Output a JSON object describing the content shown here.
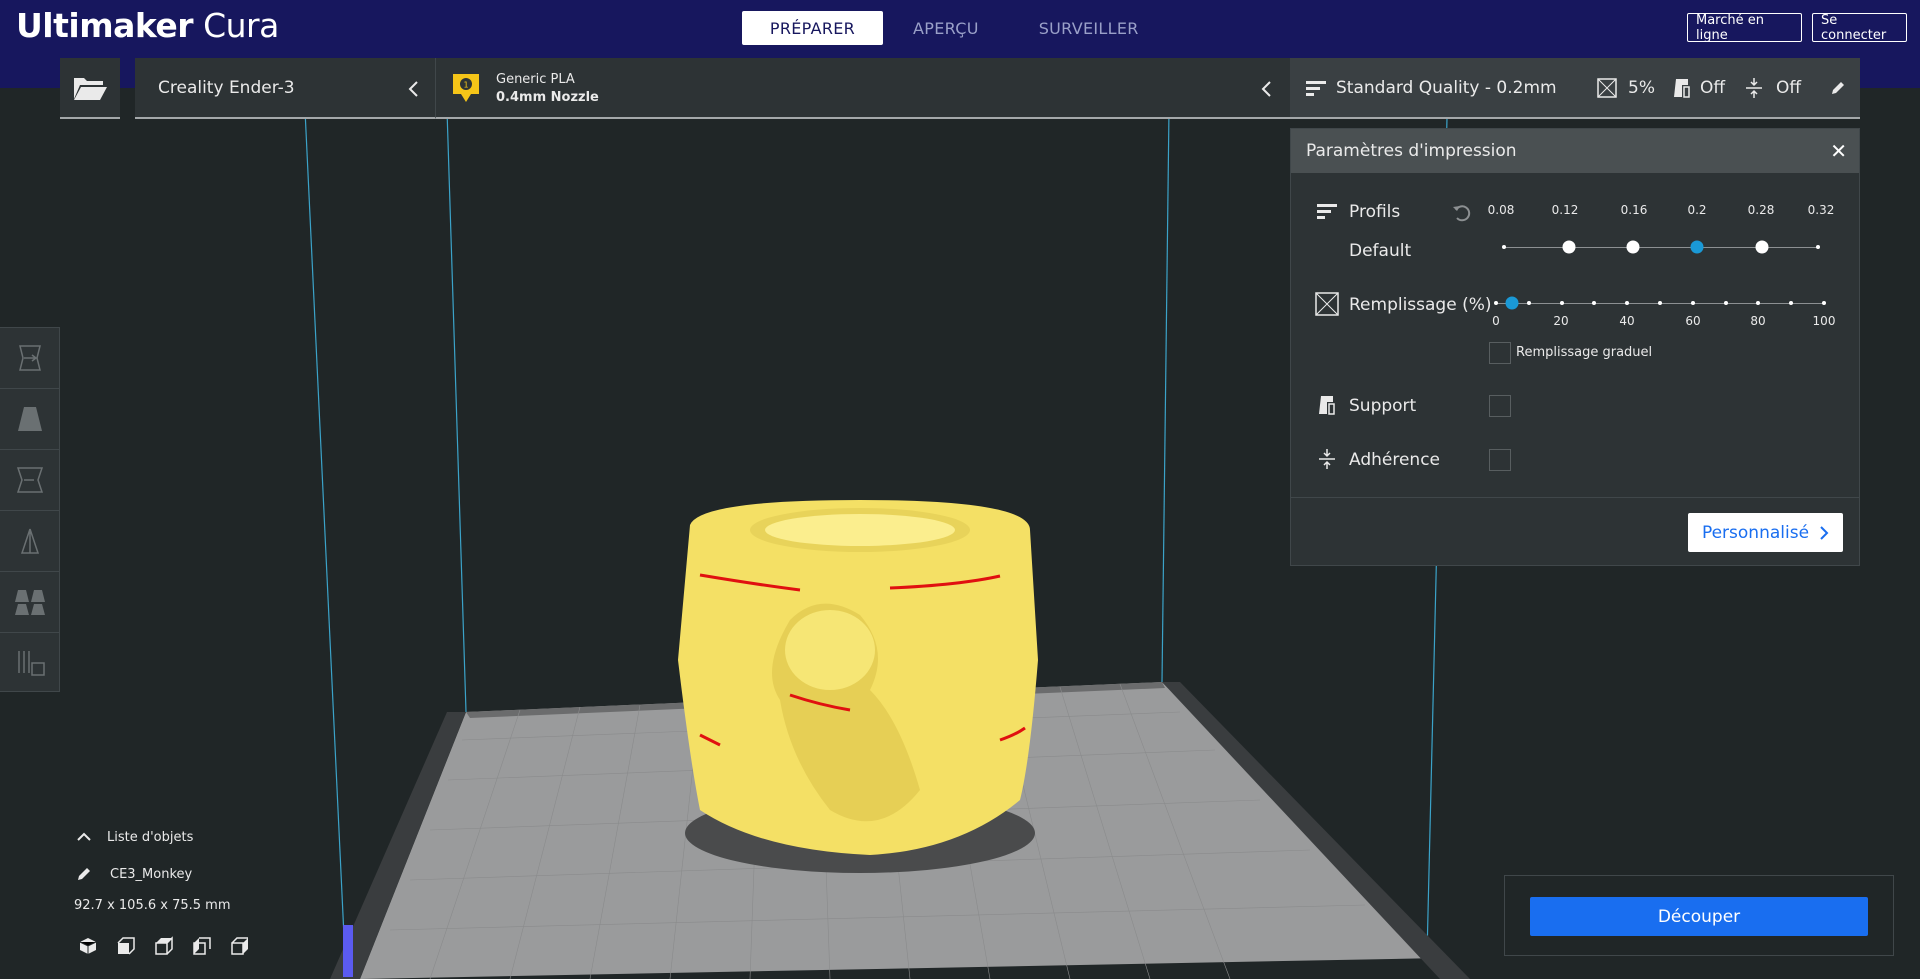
{
  "app": {
    "brand_bold": "Ultimaker",
    "brand_light": "Cura"
  },
  "stages": [
    {
      "label": "PRÉPARER",
      "active": true
    },
    {
      "label": "APERÇU",
      "active": false
    },
    {
      "label": "SURVEILLER",
      "active": false
    }
  ],
  "header_buttons": {
    "marketplace": "Marché en ligne",
    "signin": "Se connecter"
  },
  "printer": {
    "name": "Creality Ender-3"
  },
  "material": {
    "name": "Generic PLA",
    "nozzle": "0.4mm Nozzle",
    "extruder_index": "1"
  },
  "quality_bar": {
    "profile": "Standard Quality - 0.2mm",
    "infill": "5%",
    "support": "Off",
    "adhesion": "Off"
  },
  "print_settings": {
    "title": "Paramètres d'impression",
    "profiles_label": "Profils",
    "profile_default": "Default",
    "layer_heights": [
      "0.08",
      "0.12",
      "0.16",
      "0.2",
      "0.28",
      "0.32"
    ],
    "selected_layer_height": "0.2",
    "infill_label": "Remplissage (%)",
    "infill_ticks": [
      "0",
      "20",
      "40",
      "60",
      "80",
      "100"
    ],
    "infill_value": 5,
    "gradual_infill_label": "Remplissage graduel",
    "gradual_infill_checked": false,
    "support_label": "Support",
    "support_checked": false,
    "adhesion_label": "Adhérence",
    "adhesion_checked": false,
    "custom_button": "Personnalisé"
  },
  "object_list": {
    "toggle_label": "Liste d'objets",
    "object_name": "CE3_Monkey",
    "dimensions": "92.7 x 105.6 x 75.5 mm"
  },
  "slice_button": "Découper",
  "colors": {
    "header_bg": "#17175e",
    "accent_blue": "#196ef0",
    "slider_blue": "#1a99d6",
    "model_yellow": "#f4e065",
    "overhang_red": "#e01010",
    "viewport_bg": "#202627"
  },
  "icons": {
    "left_toolbar": [
      "move-icon",
      "scale-icon",
      "rotate-icon",
      "mirror-icon",
      "per-model-settings-icon",
      "support-blocker-icon"
    ],
    "view_modes": [
      "3d-view-icon",
      "front-view-icon",
      "top-view-icon",
      "left-view-icon",
      "right-view-icon"
    ]
  }
}
